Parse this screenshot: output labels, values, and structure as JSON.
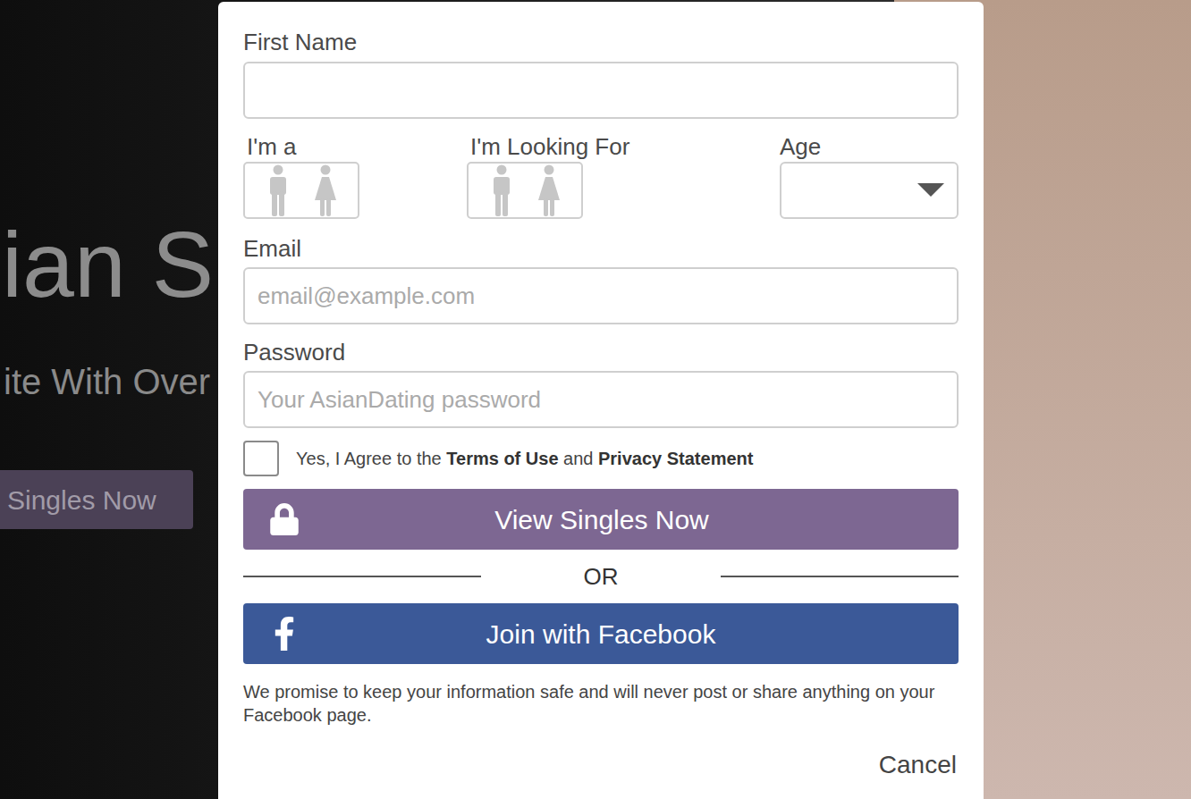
{
  "background": {
    "headline": "ian S",
    "subheadline": "ite With Over",
    "cta": "Singles Now"
  },
  "form": {
    "first_name": {
      "label": "First Name",
      "value": ""
    },
    "im_a": {
      "label": "I'm a",
      "options": [
        {
          "kind": "male",
          "selected": false
        },
        {
          "kind": "female",
          "selected": false
        }
      ]
    },
    "looking_for": {
      "label": "I'm Looking For",
      "options": [
        {
          "kind": "male",
          "selected": false
        },
        {
          "kind": "female",
          "selected": false
        }
      ]
    },
    "age": {
      "label": "Age",
      "value": ""
    },
    "email": {
      "label": "Email",
      "placeholder": "email@example.com",
      "value": ""
    },
    "password": {
      "label": "Password",
      "placeholder": "Your AsianDating password",
      "value": ""
    },
    "agree": {
      "checked": false,
      "parts": [
        {
          "text": "Yes, I Agree to the ",
          "bold": false
        },
        {
          "text": "Terms of Use",
          "bold": true
        },
        {
          "text": " and ",
          "bold": false
        },
        {
          "text": "Privacy Statement",
          "bold": true
        }
      ]
    },
    "submit": "View Singles Now",
    "divider": "OR",
    "facebook": "Join with Facebook",
    "note": "We promise to keep your information safe and will never post or share anything on your Facebook page.",
    "cancel": "Cancel"
  }
}
